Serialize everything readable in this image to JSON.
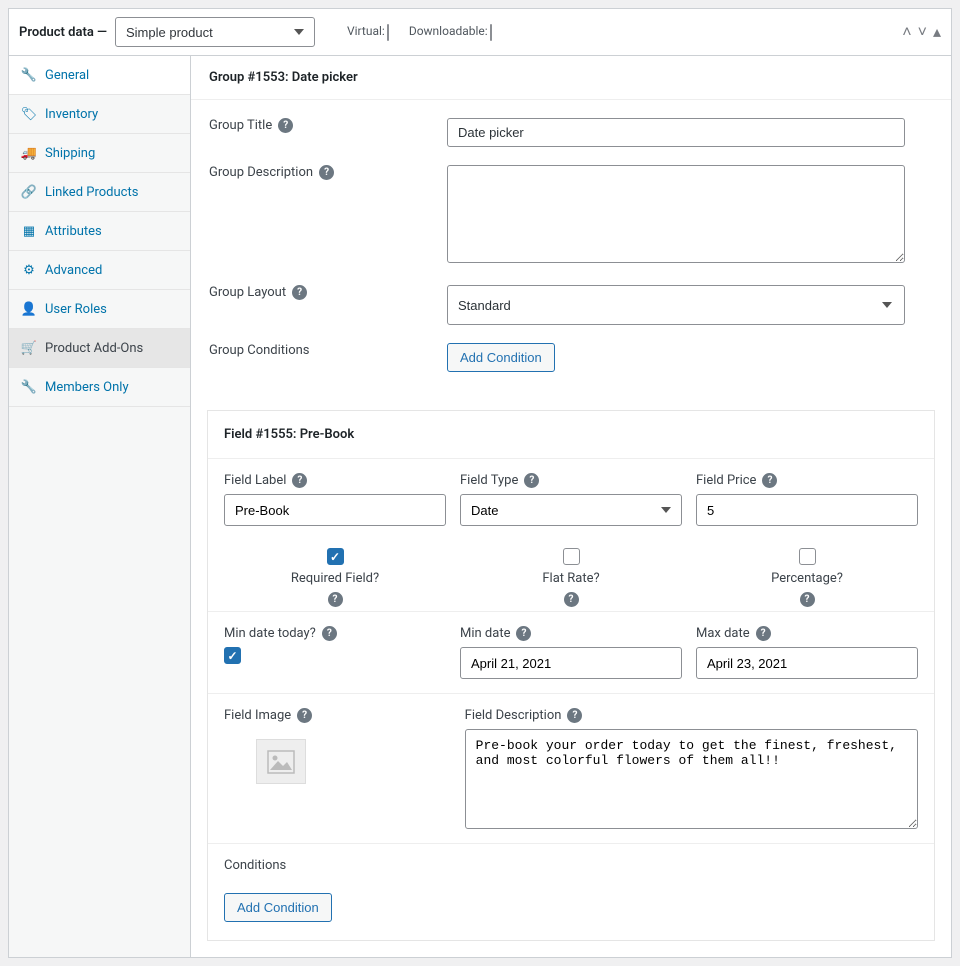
{
  "header": {
    "title": "Product data —",
    "product_type": "Simple product",
    "virtual_label": "Virtual:",
    "downloadable_label": "Downloadable:"
  },
  "sidebar": {
    "items": [
      {
        "label": "General"
      },
      {
        "label": "Inventory"
      },
      {
        "label": "Shipping"
      },
      {
        "label": "Linked Products"
      },
      {
        "label": "Attributes"
      },
      {
        "label": "Advanced"
      },
      {
        "label": "User Roles"
      },
      {
        "label": "Product Add-Ons"
      },
      {
        "label": "Members Only"
      }
    ]
  },
  "group": {
    "heading": "Group #1553: Date picker",
    "title_label": "Group Title",
    "title_value": "Date picker",
    "desc_label": "Group Description",
    "desc_value": "",
    "layout_label": "Group Layout",
    "layout_value": "Standard",
    "conditions_label": "Group Conditions",
    "add_condition": "Add Condition"
  },
  "field": {
    "heading": "Field #1555: Pre-Book",
    "label_label": "Field Label",
    "label_value": "Pre-Book",
    "type_label": "Field Type",
    "type_value": "Date",
    "price_label": "Field Price",
    "price_value": "5",
    "required_label": "Required Field?",
    "flat_rate_label": "Flat Rate?",
    "percentage_label": "Percentage?",
    "min_today_label": "Min date today?",
    "min_date_label": "Min date",
    "min_date_value": "April 21, 2021",
    "max_date_label": "Max date",
    "max_date_value": "April 23, 2021",
    "image_label": "Field Image",
    "desc_label": "Field Description",
    "desc_value": "Pre-book your order today to get the finest, freshest, and most colorful flowers of them all!!",
    "conditions_label": "Conditions",
    "add_condition": "Add Condition"
  }
}
